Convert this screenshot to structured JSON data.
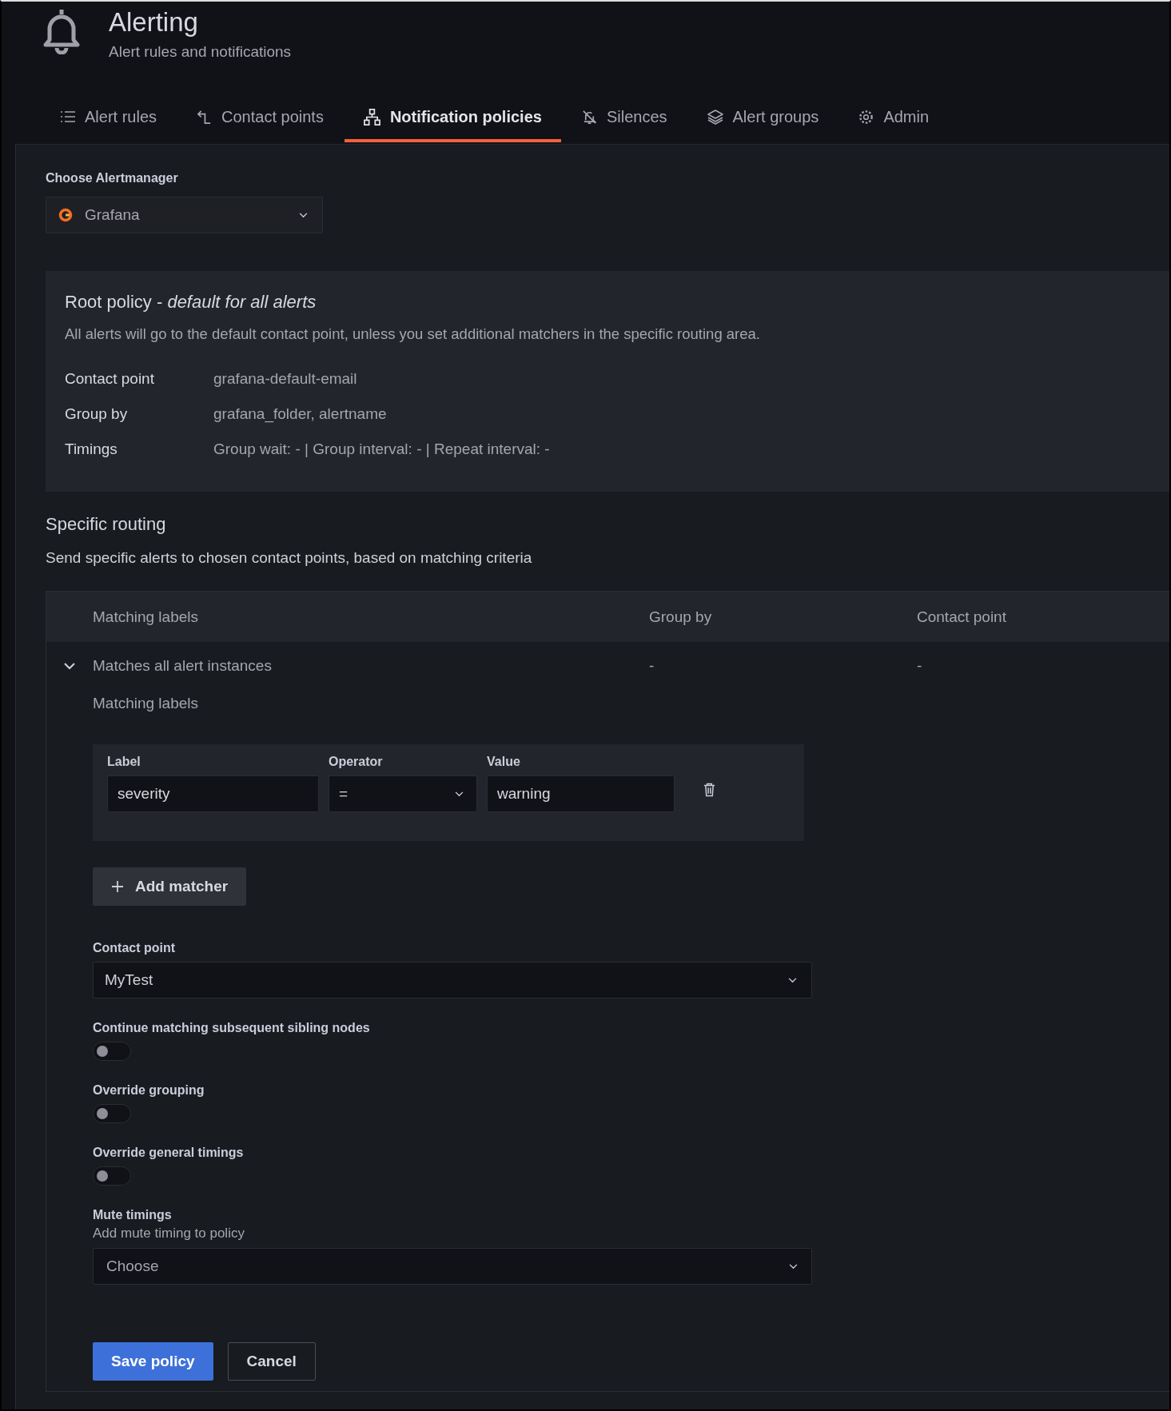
{
  "header": {
    "title": "Alerting",
    "subtitle": "Alert rules and notifications"
  },
  "tabs": [
    {
      "label": "Alert rules",
      "selected": false
    },
    {
      "label": "Contact points",
      "selected": false
    },
    {
      "label": "Notification policies",
      "selected": true
    },
    {
      "label": "Silences",
      "selected": false
    },
    {
      "label": "Alert groups",
      "selected": false
    },
    {
      "label": "Admin",
      "selected": false
    }
  ],
  "alertmanager": {
    "label": "Choose Alertmanager",
    "value": "Grafana"
  },
  "root_policy": {
    "title": "Root policy - *default for all alerts*",
    "description": "All alerts will go to the default contact point, unless you set additional matchers in the specific routing area.",
    "details": [
      {
        "label": "Contact point",
        "value": "grafana-default-email"
      },
      {
        "label": "Group by",
        "value": "grafana_folder, alertname"
      },
      {
        "label": "Timings",
        "value": "Group wait: - | Group interval: - | Repeat interval: -"
      }
    ]
  },
  "specific_routing": {
    "title": "Specific routing",
    "description": "Send specific alerts to chosen contact points, based on matching criteria"
  },
  "routes_table": {
    "columns": [
      "Matching labels",
      "Group by",
      "Contact point"
    ],
    "rows": [
      {
        "expanded": true,
        "matching": "Matches all alert instances",
        "group_by": "-",
        "contact_point": "-"
      }
    ]
  },
  "route_editor": {
    "heading": "Matching labels",
    "matcher_columns": [
      "Label",
      "Operator",
      "Value"
    ],
    "matchers": [
      {
        "label": "severity",
        "operator": "=",
        "value": "warning"
      }
    ],
    "add_button": "Add matcher",
    "contact_point": {
      "label": "Contact point",
      "value": "MyTest"
    },
    "toggles": [
      {
        "label": "Continue matching subsequent sibling nodes",
        "on": false
      },
      {
        "label": "Override grouping",
        "on": false
      },
      {
        "label": "Override general timings",
        "on": false
      }
    ],
    "mute_timings": {
      "label": "Mute timings",
      "hint": "Add mute timing to policy",
      "placeholder": "Choose"
    },
    "buttons": [
      {
        "label": "Save policy",
        "kind": "primary"
      },
      {
        "label": "Cancel",
        "kind": "secondary"
      }
    ]
  }
}
